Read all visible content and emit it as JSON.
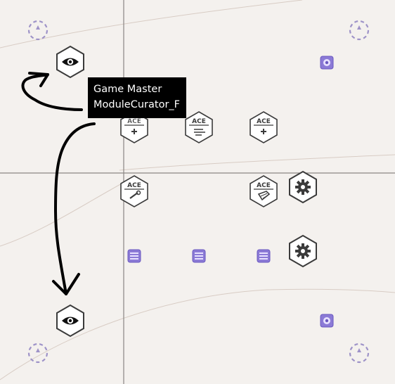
{
  "tooltip": {
    "line1": "Game Master",
    "line2": "ModuleCurator_F"
  },
  "modules": {
    "ace_label": "ACE"
  },
  "colors": {
    "background": "#f4f1ee",
    "grid": "#8a8683",
    "contour": "#d8ccc4",
    "icon_stroke": "#3b3b3b",
    "respawn_marker": "#9e93c8",
    "unit_marker": "#8b7ad6"
  },
  "icons": [
    "eye-icon",
    "gear-icon",
    "ace-medical-icon",
    "ace-wind-icon",
    "ace-repair-icon",
    "ace-hand-icon",
    "respawn-marker-icon",
    "unit-marker-icon",
    "arrow-icon"
  ]
}
